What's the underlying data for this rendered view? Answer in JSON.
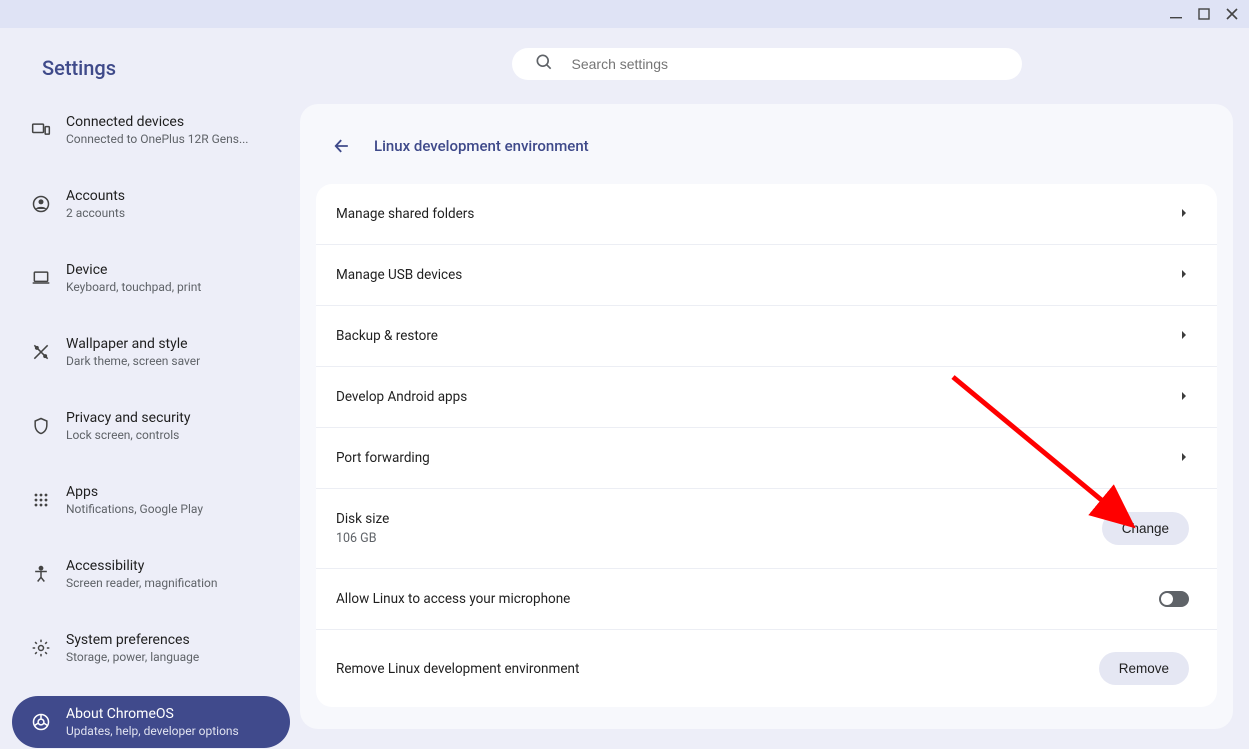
{
  "titlebar": {
    "app": "Settings"
  },
  "sidebar": {
    "title": "Settings",
    "items": [
      {
        "icon": "devices",
        "label": "Connected devices",
        "sub": "Connected to OnePlus 12R Gens..."
      },
      {
        "icon": "account",
        "label": "Accounts",
        "sub": "2 accounts"
      },
      {
        "icon": "laptop",
        "label": "Device",
        "sub": "Keyboard, touchpad, print"
      },
      {
        "icon": "wallpaper",
        "label": "Wallpaper and style",
        "sub": "Dark theme, screen saver"
      },
      {
        "icon": "shield",
        "label": "Privacy and security",
        "sub": "Lock screen, controls"
      },
      {
        "icon": "apps",
        "label": "Apps",
        "sub": "Notifications, Google Play"
      },
      {
        "icon": "accessibility",
        "label": "Accessibility",
        "sub": "Screen reader, magnification"
      },
      {
        "icon": "gear",
        "label": "System preferences",
        "sub": "Storage, power, language"
      },
      {
        "icon": "chrome",
        "label": "About ChromeOS",
        "sub": "Updates, help, developer options",
        "active": true
      }
    ]
  },
  "search": {
    "placeholder": "Search settings"
  },
  "page": {
    "title": "Linux development environment",
    "rows": [
      {
        "title": "Manage shared folders",
        "action": "chevron"
      },
      {
        "title": "Manage USB devices",
        "action": "chevron"
      },
      {
        "title": "Backup & restore",
        "action": "chevron"
      },
      {
        "title": "Develop Android apps",
        "action": "chevron"
      },
      {
        "title": "Port forwarding",
        "action": "chevron"
      },
      {
        "title": "Disk size",
        "sub": "106 GB",
        "action": "button",
        "button_label": "Change"
      },
      {
        "title": "Allow Linux to access your microphone",
        "action": "toggle",
        "toggle_on": false
      },
      {
        "title": "Remove Linux development environment",
        "action": "button",
        "button_label": "Remove"
      }
    ]
  }
}
